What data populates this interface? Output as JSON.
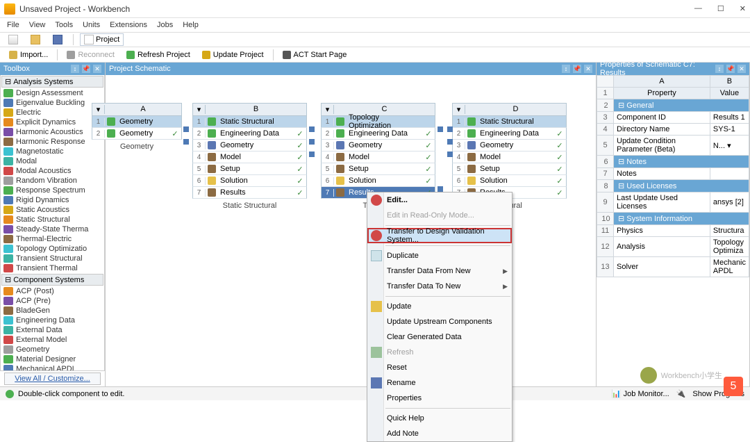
{
  "window": {
    "title": "Unsaved Project - Workbench"
  },
  "menu": [
    "File",
    "View",
    "Tools",
    "Units",
    "Extensions",
    "Jobs",
    "Help"
  ],
  "quickbar": {
    "project": "Project"
  },
  "toolbar": {
    "import": "Import...",
    "reconnect": "Reconnect",
    "refresh": "Refresh Project",
    "update": "Update Project",
    "act": "ACT Start Page"
  },
  "toolbox": {
    "title": "Toolbox",
    "cats": {
      "analysis": "Analysis Systems",
      "component": "Component Systems"
    },
    "analysis_items": [
      "Design Assessment",
      "Eigenvalue Buckling",
      "Electric",
      "Explicit Dynamics",
      "Harmonic Acoustics",
      "Harmonic Response",
      "Magnetostatic",
      "Modal",
      "Modal Acoustics",
      "Random Vibration",
      "Response Spectrum",
      "Rigid Dynamics",
      "Static Acoustics",
      "Static Structural",
      "Steady-State Therma",
      "Thermal-Electric",
      "Topology Optimizatio",
      "Transient Structural",
      "Transient Thermal"
    ],
    "component_items": [
      "ACP (Post)",
      "ACP (Pre)",
      "BladeGen",
      "Engineering Data",
      "External Data",
      "External Model",
      "Geometry",
      "Material Designer",
      "Mechanical APDL"
    ],
    "view_all": "View All / Customize..."
  },
  "schematic": {
    "title": "Project Schematic",
    "colA": {
      "letter": "A",
      "title": "Geometry",
      "rows": [
        "Geometry"
      ],
      "caption": "Geometry"
    },
    "colB": {
      "letter": "B",
      "title": "Static Structural",
      "rows": [
        "Engineering Data",
        "Geometry",
        "Model",
        "Setup",
        "Solution",
        "Results"
      ],
      "caption": "Static Structural"
    },
    "colC": {
      "letter": "C",
      "title": "Topology Optimization",
      "rows": [
        "Engineering Data",
        "Geometry",
        "Model",
        "Setup",
        "Solution",
        "Results"
      ],
      "caption": "Topology "
    },
    "colD": {
      "letter": "D",
      "title": "Static Structural",
      "rows": [
        "Engineering Data",
        "Geometry",
        "Model",
        "Setup",
        "Solution",
        "Results"
      ],
      "caption": "ructural"
    }
  },
  "ctx": {
    "edit": "Edit...",
    "editro": "Edit in Read-Only Mode...",
    "transfer_dvs": "Transfer to Design Validation System...",
    "duplicate": "Duplicate",
    "transfer_from": "Transfer Data From New",
    "transfer_to": "Transfer Data To New",
    "update": "Update",
    "update_up": "Update Upstream Components",
    "clear_gen": "Clear Generated Data",
    "refresh": "Refresh",
    "reset": "Reset",
    "rename": "Rename",
    "properties": "Properties",
    "quickhelp": "Quick Help",
    "addnote": "Add Note"
  },
  "props": {
    "title": "Properties of Schematic C7: Results",
    "hdr_a": "A",
    "hdr_b": "B",
    "col_prop": "Property",
    "col_val": "Value",
    "grp_general": "General",
    "grp_notes": "Notes",
    "grp_lic": "Used Licenses",
    "grp_sys": "System Information",
    "rows": {
      "r3k": "Component ID",
      "r3v": "Results 1",
      "r4k": "Directory Name",
      "r4v": "SYS-1",
      "r5k": "Update Condition Parameter (Beta)",
      "r5v": "N...",
      "r7k": "Notes",
      "r7v": "",
      "r9k": "Last Update Used Licenses",
      "r9v": "ansys [2]",
      "r11k": "Physics",
      "r11v": "Structura",
      "r12k": "Analysis",
      "r12v": "Topology Optimiza",
      "r13k": "Solver",
      "r13v": "Mechanic APDL"
    }
  },
  "status": {
    "hint": "Double-click component to edit.",
    "jobmon": "Job Monitor...",
    "show_prog": "Show Progress"
  },
  "watermark": "Workbench小学生"
}
